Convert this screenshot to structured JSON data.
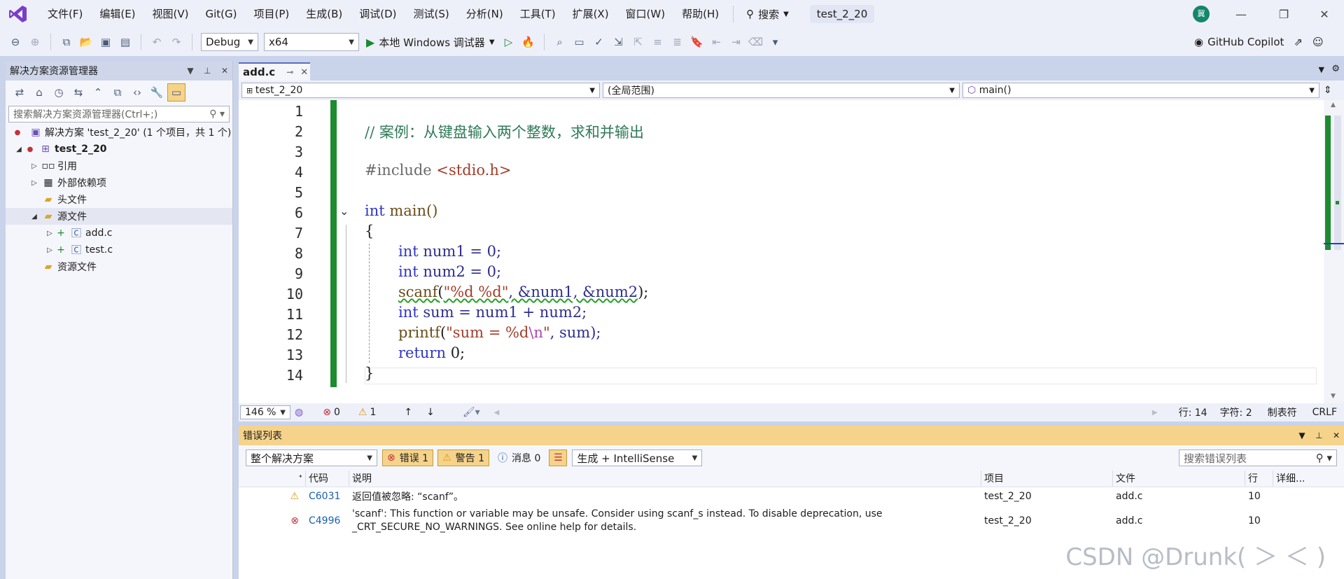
{
  "menu": [
    "文件(F)",
    "编辑(E)",
    "视图(V)",
    "Git(G)",
    "项目(P)",
    "生成(B)",
    "调试(D)",
    "测试(S)",
    "分析(N)",
    "工具(T)",
    "扩展(X)",
    "窗口(W)",
    "帮助(H)"
  ],
  "search_label": "搜索",
  "window_title": "test_2_20",
  "avatar_text": "冀",
  "toolbar": {
    "config": "Debug",
    "platform": "x64",
    "run_label": "本地 Windows 调试器",
    "copilot": "GitHub Copilot"
  },
  "solution": {
    "title": "解决方案资源管理器",
    "search_placeholder": "搜索解决方案资源管理器(Ctrl+;)",
    "root": "解决方案 'test_2_20' (1 个项目，共 1 个)",
    "project": "test_2_20",
    "items": [
      "引用",
      "外部依赖项",
      "头文件",
      "源文件",
      "add.c",
      "test.c",
      "资源文件"
    ]
  },
  "editor": {
    "tab": "add.c",
    "nav_project": "test_2_20",
    "nav_scope": "(全局范围)",
    "nav_func": "main()",
    "line_numbers": [
      "1",
      "2",
      "3",
      "4",
      "5",
      "6",
      "7",
      "8",
      "9",
      "10",
      "11",
      "12",
      "13",
      "14"
    ],
    "code": {
      "comment": "// 案例：从键盘输入两个整数，求和并输出",
      "include_kw": "#include",
      "include_file": "<stdio.h>",
      "int": "int",
      "main": "main()",
      "brace_open": "{",
      "brace_close": "}",
      "num1_decl": "num1 = 0;",
      "num2_decl": "num2 = 0;",
      "scanf": "scanf",
      "scanf_fmt": "\"%d %d\"",
      "scanf_args": ", &num1, &num2",
      "scanf_end": ");",
      "sum_decl": "sum = num1 + num2;",
      "printf": "printf",
      "printf_fmt_a": "\"sum = %d",
      "printf_esc": "\\n",
      "printf_fmt_b": "\"",
      "printf_args": ", sum);",
      "return": "return",
      "return_val": "0;"
    }
  },
  "status": {
    "zoom": "146 %",
    "errors": "0",
    "warnings": "1",
    "line": "行: 14",
    "char": "字符: 2",
    "tabs": "制表符",
    "eol": "CRLF"
  },
  "errlist": {
    "title": "错误列表",
    "scope": "整个解决方案",
    "btn_errors": "错误 1",
    "btn_warnings": "警告 1",
    "btn_messages": "消息 0",
    "filter": "生成 + IntelliSense",
    "search_placeholder": "搜索错误列表",
    "headers": {
      "code": "代码",
      "desc": "说明",
      "project": "项目",
      "file": "文件",
      "line": "行",
      "detail": "详细..."
    },
    "rows": [
      {
        "code": "C6031",
        "desc": "返回值被忽略: “scanf”。",
        "project": "test_2_20",
        "file": "add.c",
        "line": "10"
      },
      {
        "code": "C4996",
        "desc": "'scanf': This function or variable may be unsafe. Consider using scanf_s instead. To disable deprecation, use _CRT_SECURE_NO_WARNINGS. See online help for details.",
        "project": "test_2_20",
        "file": "add.c",
        "line": "10"
      }
    ]
  },
  "watermark": "CSDN @Drunk( ＞ ＜ )"
}
